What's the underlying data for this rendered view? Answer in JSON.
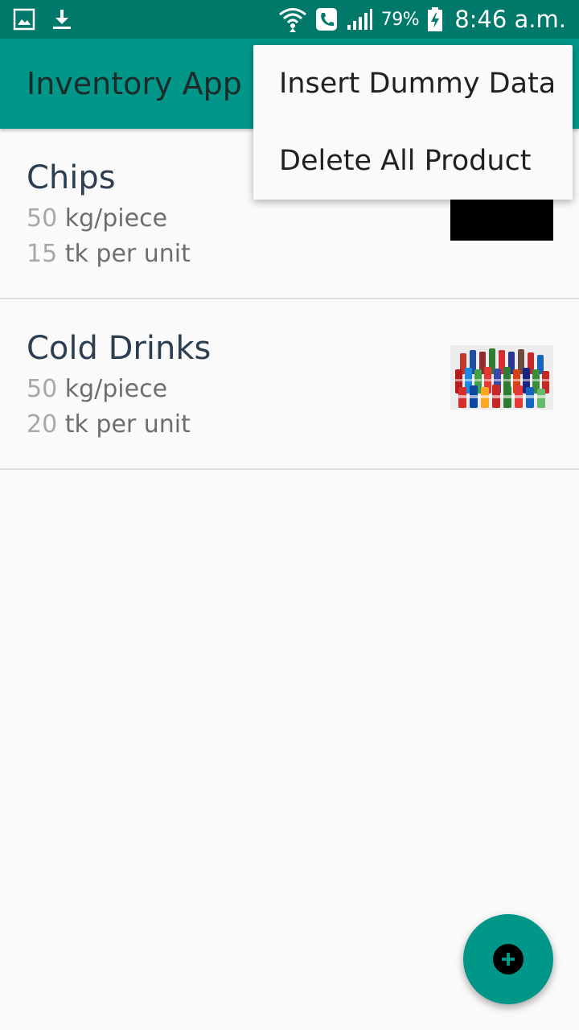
{
  "status_bar": {
    "battery_percent": "79%",
    "time": "8:46 a.m.",
    "icons": [
      "gallery-icon",
      "download-icon",
      "wifi-icon",
      "call-icon",
      "signal-icon",
      "battery-charging-icon"
    ]
  },
  "app_bar": {
    "title": "Inventory App"
  },
  "overflow_menu": {
    "items": [
      {
        "label": "Insert Dummy Data"
      },
      {
        "label": "Delete All Product"
      }
    ]
  },
  "products": [
    {
      "name": "Chips",
      "weight_value": "50",
      "weight_unit": "kg/piece",
      "price_value": "15",
      "price_unit": "tk per unit",
      "thumbnail": "black-placeholder"
    },
    {
      "name": "Cold Drinks",
      "weight_value": "50",
      "weight_unit": "kg/piece",
      "price_value": "20",
      "price_unit": "tk per unit",
      "thumbnail": "bottles-photo"
    }
  ],
  "fab": {
    "icon": "add-icon"
  },
  "colors": {
    "status_bar": "#00796b",
    "primary": "#009688",
    "background": "#fafafa"
  }
}
